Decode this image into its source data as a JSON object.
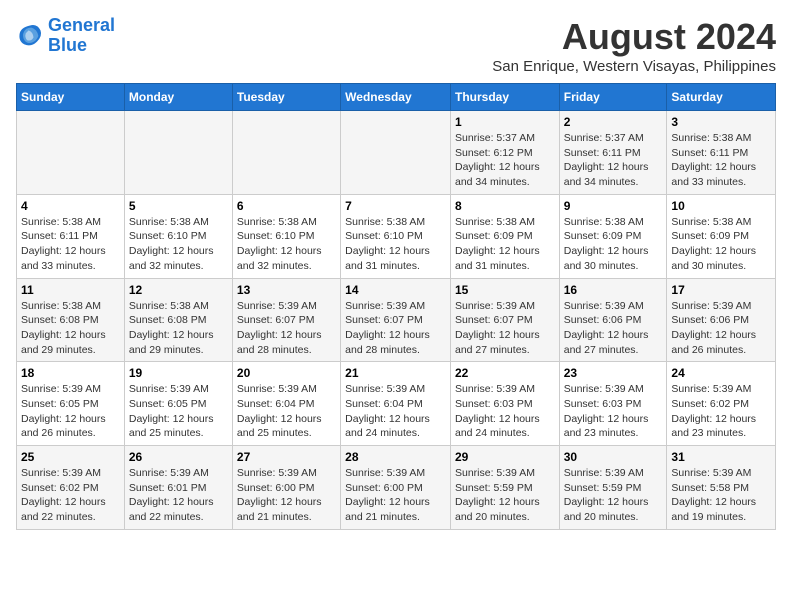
{
  "logo": {
    "line1": "General",
    "line2": "Blue"
  },
  "title": "August 2024",
  "subtitle": "San Enrique, Western Visayas, Philippines",
  "days_of_week": [
    "Sunday",
    "Monday",
    "Tuesday",
    "Wednesday",
    "Thursday",
    "Friday",
    "Saturday"
  ],
  "weeks": [
    {
      "days": [
        {
          "num": "",
          "info": ""
        },
        {
          "num": "",
          "info": ""
        },
        {
          "num": "",
          "info": ""
        },
        {
          "num": "",
          "info": ""
        },
        {
          "num": "1",
          "info": "Sunrise: 5:37 AM\nSunset: 6:12 PM\nDaylight: 12 hours\nand 34 minutes."
        },
        {
          "num": "2",
          "info": "Sunrise: 5:37 AM\nSunset: 6:11 PM\nDaylight: 12 hours\nand 34 minutes."
        },
        {
          "num": "3",
          "info": "Sunrise: 5:38 AM\nSunset: 6:11 PM\nDaylight: 12 hours\nand 33 minutes."
        }
      ]
    },
    {
      "days": [
        {
          "num": "4",
          "info": "Sunrise: 5:38 AM\nSunset: 6:11 PM\nDaylight: 12 hours\nand 33 minutes."
        },
        {
          "num": "5",
          "info": "Sunrise: 5:38 AM\nSunset: 6:10 PM\nDaylight: 12 hours\nand 32 minutes."
        },
        {
          "num": "6",
          "info": "Sunrise: 5:38 AM\nSunset: 6:10 PM\nDaylight: 12 hours\nand 32 minutes."
        },
        {
          "num": "7",
          "info": "Sunrise: 5:38 AM\nSunset: 6:10 PM\nDaylight: 12 hours\nand 31 minutes."
        },
        {
          "num": "8",
          "info": "Sunrise: 5:38 AM\nSunset: 6:09 PM\nDaylight: 12 hours\nand 31 minutes."
        },
        {
          "num": "9",
          "info": "Sunrise: 5:38 AM\nSunset: 6:09 PM\nDaylight: 12 hours\nand 30 minutes."
        },
        {
          "num": "10",
          "info": "Sunrise: 5:38 AM\nSunset: 6:09 PM\nDaylight: 12 hours\nand 30 minutes."
        }
      ]
    },
    {
      "days": [
        {
          "num": "11",
          "info": "Sunrise: 5:38 AM\nSunset: 6:08 PM\nDaylight: 12 hours\nand 29 minutes."
        },
        {
          "num": "12",
          "info": "Sunrise: 5:38 AM\nSunset: 6:08 PM\nDaylight: 12 hours\nand 29 minutes."
        },
        {
          "num": "13",
          "info": "Sunrise: 5:39 AM\nSunset: 6:07 PM\nDaylight: 12 hours\nand 28 minutes."
        },
        {
          "num": "14",
          "info": "Sunrise: 5:39 AM\nSunset: 6:07 PM\nDaylight: 12 hours\nand 28 minutes."
        },
        {
          "num": "15",
          "info": "Sunrise: 5:39 AM\nSunset: 6:07 PM\nDaylight: 12 hours\nand 27 minutes."
        },
        {
          "num": "16",
          "info": "Sunrise: 5:39 AM\nSunset: 6:06 PM\nDaylight: 12 hours\nand 27 minutes."
        },
        {
          "num": "17",
          "info": "Sunrise: 5:39 AM\nSunset: 6:06 PM\nDaylight: 12 hours\nand 26 minutes."
        }
      ]
    },
    {
      "days": [
        {
          "num": "18",
          "info": "Sunrise: 5:39 AM\nSunset: 6:05 PM\nDaylight: 12 hours\nand 26 minutes."
        },
        {
          "num": "19",
          "info": "Sunrise: 5:39 AM\nSunset: 6:05 PM\nDaylight: 12 hours\nand 25 minutes."
        },
        {
          "num": "20",
          "info": "Sunrise: 5:39 AM\nSunset: 6:04 PM\nDaylight: 12 hours\nand 25 minutes."
        },
        {
          "num": "21",
          "info": "Sunrise: 5:39 AM\nSunset: 6:04 PM\nDaylight: 12 hours\nand 24 minutes."
        },
        {
          "num": "22",
          "info": "Sunrise: 5:39 AM\nSunset: 6:03 PM\nDaylight: 12 hours\nand 24 minutes."
        },
        {
          "num": "23",
          "info": "Sunrise: 5:39 AM\nSunset: 6:03 PM\nDaylight: 12 hours\nand 23 minutes."
        },
        {
          "num": "24",
          "info": "Sunrise: 5:39 AM\nSunset: 6:02 PM\nDaylight: 12 hours\nand 23 minutes."
        }
      ]
    },
    {
      "days": [
        {
          "num": "25",
          "info": "Sunrise: 5:39 AM\nSunset: 6:02 PM\nDaylight: 12 hours\nand 22 minutes."
        },
        {
          "num": "26",
          "info": "Sunrise: 5:39 AM\nSunset: 6:01 PM\nDaylight: 12 hours\nand 22 minutes."
        },
        {
          "num": "27",
          "info": "Sunrise: 5:39 AM\nSunset: 6:00 PM\nDaylight: 12 hours\nand 21 minutes."
        },
        {
          "num": "28",
          "info": "Sunrise: 5:39 AM\nSunset: 6:00 PM\nDaylight: 12 hours\nand 21 minutes."
        },
        {
          "num": "29",
          "info": "Sunrise: 5:39 AM\nSunset: 5:59 PM\nDaylight: 12 hours\nand 20 minutes."
        },
        {
          "num": "30",
          "info": "Sunrise: 5:39 AM\nSunset: 5:59 PM\nDaylight: 12 hours\nand 20 minutes."
        },
        {
          "num": "31",
          "info": "Sunrise: 5:39 AM\nSunset: 5:58 PM\nDaylight: 12 hours\nand 19 minutes."
        }
      ]
    }
  ]
}
